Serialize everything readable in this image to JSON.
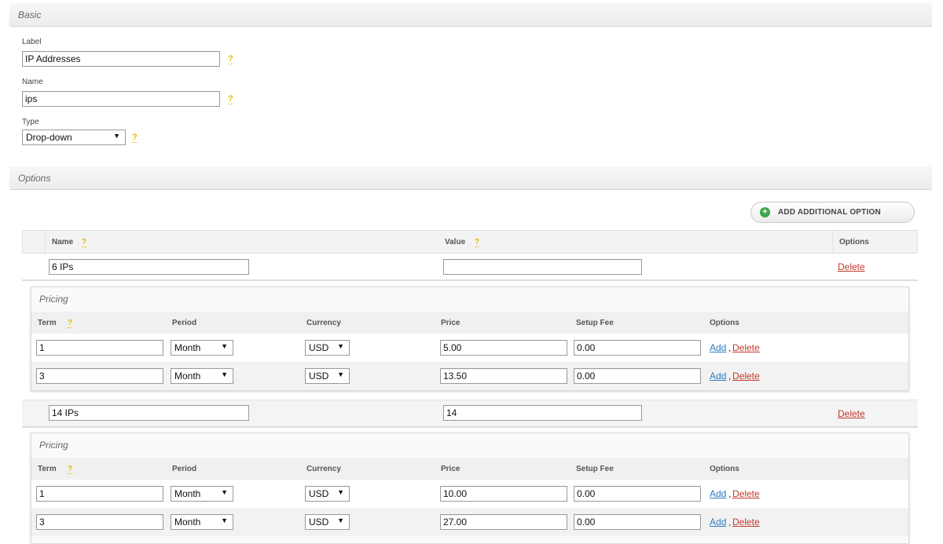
{
  "basic": {
    "title": "Basic",
    "label_label": "Label",
    "label_value": "IP Addresses",
    "name_label": "Name",
    "name_value": "ips",
    "type_label": "Type",
    "type_value": "Drop-down",
    "help": "?"
  },
  "options": {
    "title": "Options",
    "add_button": "ADD ADDITIONAL OPTION",
    "columns": {
      "name": "Name",
      "value": "Value",
      "options": "Options"
    },
    "items": [
      {
        "name": "6 IPs",
        "value": "",
        "delete": "Delete",
        "pricing": {
          "title": "Pricing",
          "columns": {
            "term": "Term",
            "period": "Period",
            "currency": "Currency",
            "price": "Price",
            "setup_fee": "Setup Fee",
            "options": "Options"
          },
          "rows": [
            {
              "term": "1",
              "period": "Month",
              "currency": "USD",
              "price": "5.00",
              "setup_fee": "0.00",
              "add": "Add",
              "sep": ",",
              "delete": "Delete"
            },
            {
              "term": "3",
              "period": "Month",
              "currency": "USD",
              "price": "13.50",
              "setup_fee": "0.00",
              "add": "Add",
              "sep": ",",
              "delete": "Delete"
            }
          ]
        }
      },
      {
        "name": "14 IPs",
        "value": "14",
        "delete": "Delete",
        "pricing": {
          "title": "Pricing",
          "columns": {
            "term": "Term",
            "period": "Period",
            "currency": "Currency",
            "price": "Price",
            "setup_fee": "Setup Fee",
            "options": "Options"
          },
          "rows": [
            {
              "term": "1",
              "period": "Month",
              "currency": "USD",
              "price": "10.00",
              "setup_fee": "0.00",
              "add": "Add",
              "sep": ",",
              "delete": "Delete"
            },
            {
              "term": "3",
              "period": "Month",
              "currency": "USD",
              "price": "27.00",
              "setup_fee": "0.00",
              "add": "Add",
              "sep": ",",
              "delete": "Delete"
            }
          ]
        }
      }
    ]
  },
  "icons": {
    "help": "help-icon",
    "plus": "plus-circle-icon",
    "dropdown": "dropdown-arrow-icon"
  },
  "colors": {
    "help": "#e6b800",
    "delete_link": "#c0392b",
    "add_link": "#2e7bbf",
    "add_icon": "#3aa54a"
  }
}
